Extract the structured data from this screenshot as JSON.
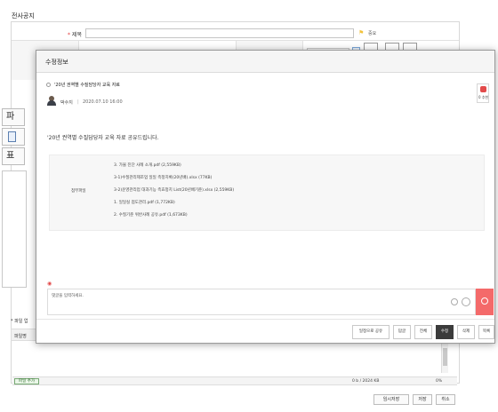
{
  "compose": {
    "header_title": "전사공지",
    "title_label": "제목",
    "required_mark": "*",
    "important_label": "중요",
    "tab_file": "파",
    "tab_standard": "표",
    "file_section_label": "* 파일 업",
    "file_col_label": "파일명",
    "add_file_label": "파일 추가",
    "size_info": "0 b / 2024 KB",
    "size_percent": "0%",
    "actions": [
      "임시저장",
      "저장",
      "취소"
    ]
  },
  "modal": {
    "title": "수정정보",
    "post_title": "'20년 권역별 수질담당자 교육 자료",
    "author": "박수지",
    "date": "2020.07.10 16:00",
    "recommend_label": "0 추천",
    "body_text": "'20년 권역별 수질담당자 교육 자료 공유드립니다.",
    "attach_label": "첨부파일",
    "attachments": [
      "3. 가물 진단 사례 소개.pdf (2,559KB)",
      "3-1)수질관리제조업 일일 측정치록(20년배).xlsx (77KB)",
      "3-2)운영관리업 대과기능 측효정치 List(20년배기준).xlsx (2,559KB)",
      "1. 일일실 점도관리.pdf (1,772KB)",
      "2. 수질기준 위반사례 공유.pdf (1,673KB)"
    ],
    "comment_placeholder": "댓글을 입력하세요.",
    "footer_buttons": [
      {
        "label": "일정으로 공유",
        "active": false
      },
      {
        "label": "답글",
        "active": false
      },
      {
        "label": "전체",
        "active": false
      },
      {
        "label": "수정",
        "active": true
      },
      {
        "label": "삭제",
        "active": false
      },
      {
        "label": "목록",
        "active": false
      }
    ]
  },
  "colors": {
    "accent_red": "#f46a6a",
    "active_button": "#3b3b3b",
    "flag_yellow": "#f2c23b"
  }
}
